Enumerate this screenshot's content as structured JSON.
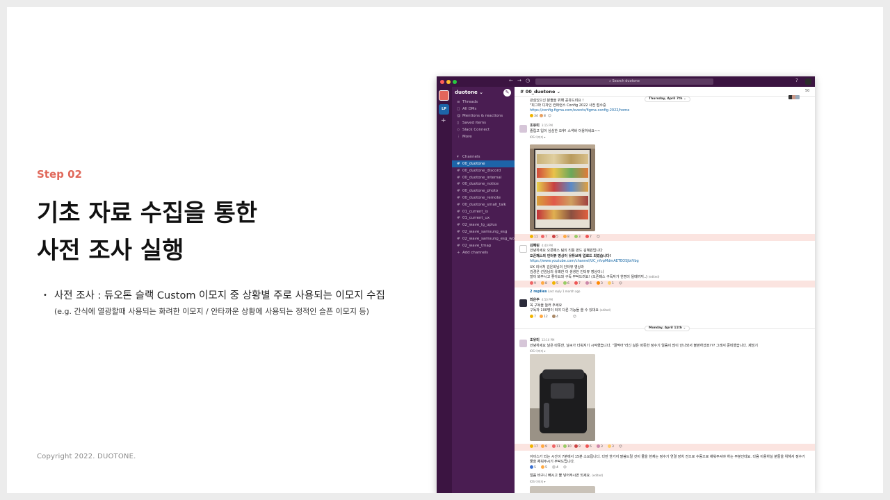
{
  "slide": {
    "step": "Step 02",
    "title_line1": "기초 자료 수집을 통한",
    "title_line2": "사전 조사 실행",
    "bullet": "사전 조사 : 듀오톤 슬랙 Custom 이모지 중 상황별 주로 사용되는 이모지 수집",
    "note": "(e.g. 간식에 열광할때 사용되는 화려한 이모지 / 안타까운 상황에 사용되는 정적인 슬픈 이모지 등)",
    "copyright": "Copyright 2022. DUOTONE."
  },
  "slack": {
    "search_placeholder": "Search duotone",
    "workspace_name": "duotone ⌄",
    "rail_label": "LP",
    "sidebar_items": [
      {
        "icon": "threads-icon",
        "glyph": "≡",
        "label": "Threads"
      },
      {
        "icon": "dm-icon",
        "glyph": "◻",
        "label": "All DMs"
      },
      {
        "icon": "at-icon",
        "glyph": "@",
        "label": "Mentions & reactions"
      },
      {
        "icon": "bookmark-icon",
        "glyph": "▯",
        "label": "Saved items"
      },
      {
        "icon": "connect-icon",
        "glyph": "◇",
        "label": "Slack Connect"
      },
      {
        "icon": "more-icon",
        "glyph": "⋮",
        "label": "More"
      }
    ],
    "channels_header": "Channels",
    "channels": [
      "00_duotone",
      "00_duotone_discord",
      "00_duotone_internal",
      "00_duotone_notice",
      "00_duotone_photo",
      "00_duotone_remote",
      "00_duotone_small_talk",
      "01_current_ix",
      "01_current_ux",
      "02_wave_lg_uplus",
      "02_wave_samsung_esg",
      "02_wave_samsung_esg_wo...",
      "02_wave_tmap"
    ],
    "add_channels": "Add channels",
    "channel_title": "# 00_duotone ⌄",
    "member_count": "50",
    "date1": "Thursday, April 7th ⌄",
    "date2": "Monday, April 11th ⌄",
    "msg0_line1": "관심있으신 분들을 위해 공유드려요 !",
    "msg0_line2": "\"피그마 디자인 컨퍼런스 Config 2022 사전 접수중",
    "msg0_link": "https://config.figma.com/events/figma-config-2022/home",
    "msg0_reacts": [
      "34",
      "8"
    ],
    "msg1_user": "조유미",
    "msg1_time": "3:15 PM",
    "msg1_text": "졸립고 입이 심심한 오후! 스낵바 이용하세요~~",
    "msg1_file": "IOS 이미지 ▾",
    "msg1_reacts": [
      "11",
      "7",
      "5",
      "8",
      "3",
      "7"
    ],
    "msg2_user": "김혜린",
    "msg2_time": "4:40 PM",
    "msg2_l1": "안녕하세요 오픈패스 팀의 리틀 펀드 김혜원입니다",
    "msg2_l2": "오픈패스의 인터뷰 영상이 유튜브에 업로드 되었습니다!",
    "msg2_link": "https://www.youtube.com/channel/UC_nfvpMdmAETEOSJbtVbg",
    "msg2_l3": "UX 리서처 김은희님의 인터뷰 영상과",
    "msg2_l4": "김경은 선임님의 유쾌한 이 생생한 인터뷰 영상이니",
    "msg2_l5": "많이 봐주시고 좋아요와 구독 부탁드려요! (오픈패스 구독자가 한명이 될때까지..)",
    "msg2_edited": "(edited)",
    "msg2_reacts": [
      "9",
      "8",
      "5",
      "6",
      "7",
      "6",
      "3",
      "1"
    ],
    "msg2_replies": "2 replies",
    "msg2_lastreply": "Last reply 1 month ago",
    "msg3_user": "최은주",
    "msg3_time": "4:50 PM",
    "msg3_l1": "꼭 구독을 눌러 주세요",
    "msg3_l2": "구독자 100명이 되야 다른 기능들 쓸 수 있대요",
    "msg3_edited": "(edited)",
    "msg3_reacts": [
      "7",
      "12",
      "4"
    ],
    "msg4_user": "조유미",
    "msg4_time": "12:10 PM",
    "msg4_text": "안녕하세요 날은 따뜻한, 날씨가 더워지기 시작했습니다. \"꿀쩍어\"라신 삶은 따뜻한 정수기 얼음이 많이 안나와서 불편하셨죠??? 그래서 준비했습니다. 제빙기",
    "msg4_file": "IOS 이미지 ▾",
    "msg4_reacts": [
      "17",
      "9",
      "11",
      "10",
      "9",
      "6",
      "3",
      "3"
    ],
    "msg5_l1": "아이스가 되는 시간이 7분에서 15분 소요됩니다. 다만 한가지 말씀드릴 것이 물을 현재는 정수기 연결 장치 전으로 수동으로 채워주셔야 하는 부분인데요. 다음 이용하실 분들을 위해서 정수기",
    "msg5_l2": "물을 채워주시기 부탁드립니다.",
    "msg5_reacts": [
      "5",
      "5",
      "4"
    ],
    "msg6_text": "얼음 바구니 빼시고 물 넣어주시면 되세요.",
    "msg6_edited": "(edited)",
    "msg6_file": "IOS 이미지 ▾"
  }
}
